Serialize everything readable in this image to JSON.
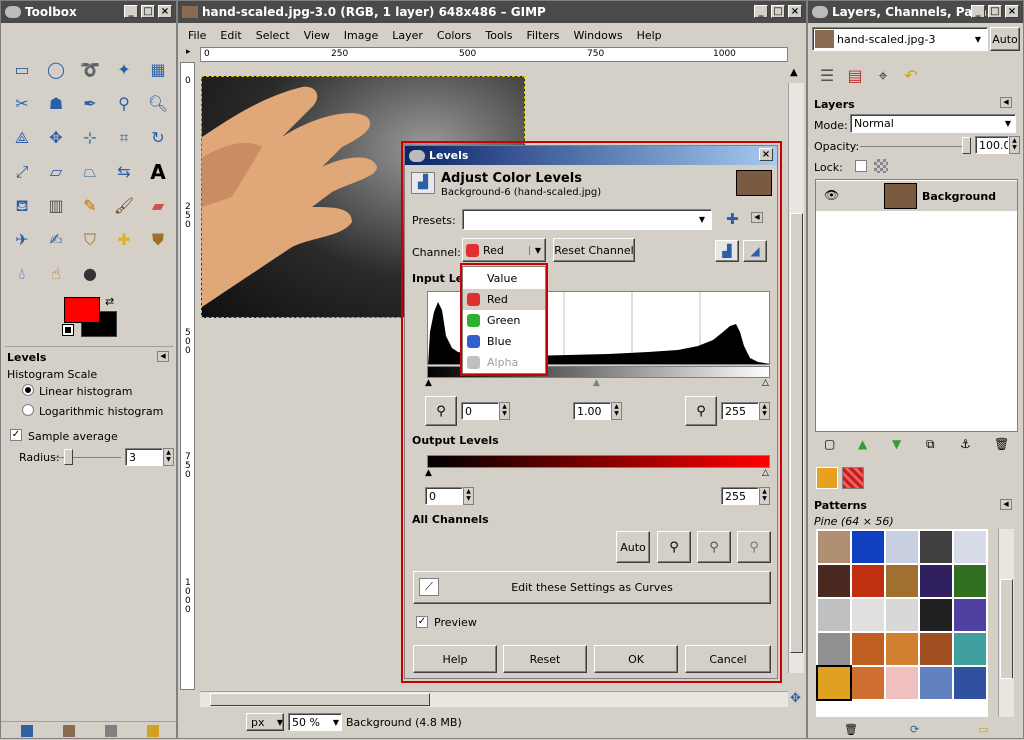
{
  "toolbox": {
    "title": "Toolbox",
    "levels_label": "Levels",
    "histogram_scale": "Histogram Scale",
    "linear": "Linear histogram",
    "logarithmic": "Logarithmic histogram",
    "sample_average": "Sample average",
    "radius_label": "Radius:",
    "radius_value": "3",
    "fg_color": "#ff0000",
    "bg_color": "#000000"
  },
  "image_window": {
    "title": "hand-scaled.jpg-3.0 (RGB, 1 layer) 648x486 – GIMP",
    "menu": [
      "File",
      "Edit",
      "Select",
      "View",
      "Image",
      "Layer",
      "Colors",
      "Tools",
      "Filters",
      "Windows",
      "Help"
    ],
    "ruler_h": [
      "0",
      "250",
      "500",
      "750",
      "1000"
    ],
    "ruler_v": [
      "0",
      "2",
      "5",
      "0",
      "5",
      "0",
      "0",
      "7",
      "5",
      "0",
      "1",
      "0",
      "0",
      "0"
    ],
    "unit": "px",
    "zoom": "50 %",
    "status": "Background (4.8 MB)"
  },
  "levels": {
    "title": "Levels",
    "heading": "Adjust Color Levels",
    "subheading": "Background-6 (hand-scaled.jpg)",
    "presets_label": "Presets:",
    "channel_label": "Channel:",
    "channel_value": "Red",
    "reset_channel": "Reset Channel",
    "input_levels": "Input Levels",
    "input_low": "0",
    "input_gamma": "1.00",
    "input_high": "255",
    "output_levels": "Output Levels",
    "output_low": "0",
    "output_high": "255",
    "all_channels": "All Channels",
    "auto": "Auto",
    "edit_curves": "Edit these Settings as Curves",
    "preview": "Preview",
    "help": "Help",
    "reset": "Reset",
    "ok": "OK",
    "cancel": "Cancel",
    "channel_options": [
      {
        "label": "Value",
        "color": ""
      },
      {
        "label": "Red",
        "color": "#e03030"
      },
      {
        "label": "Green",
        "color": "#30b030"
      },
      {
        "label": "Blue",
        "color": "#3060d0"
      },
      {
        "label": "Alpha",
        "color": "#a0a0a0"
      }
    ],
    "accent": "#cc0000"
  },
  "layers_panel": {
    "title": "Layers, Channels, Path...",
    "image_select": "hand-scaled.jpg-3",
    "auto": "Auto",
    "section": "Layers",
    "mode_label": "Mode:",
    "mode_value": "Normal",
    "opacity_label": "Opacity:",
    "opacity_value": "100.0",
    "lock_label": "Lock:",
    "layer_name": "Background",
    "patterns_label": "Patterns",
    "pattern_name": "Pine (64 × 56)"
  }
}
